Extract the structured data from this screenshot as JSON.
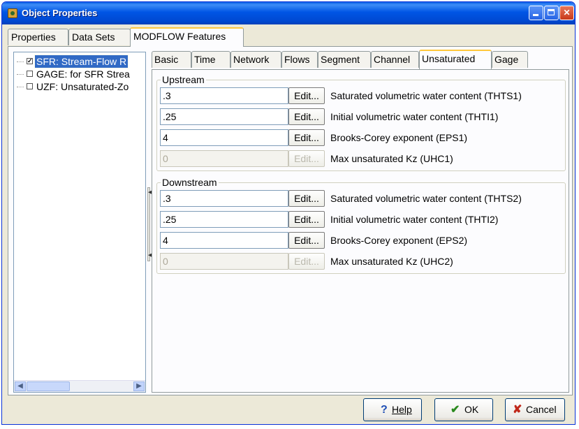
{
  "window": {
    "title": "Object Properties"
  },
  "tabs": [
    {
      "label": "Properties"
    },
    {
      "label": "Data Sets"
    },
    {
      "label": "MODFLOW Features"
    }
  ],
  "tree": {
    "items": [
      {
        "label": "SFR: Stream-Flow R",
        "checked": "✓"
      },
      {
        "label": "GAGE: for SFR Strea",
        "checked": ""
      },
      {
        "label": "UZF: Unsaturated-Zo",
        "checked": ""
      }
    ]
  },
  "subtabs": [
    {
      "label": "Basic"
    },
    {
      "label": "Time"
    },
    {
      "label": "Network"
    },
    {
      "label": "Flows"
    },
    {
      "label": "Segment"
    },
    {
      "label": "Channel"
    },
    {
      "label": "Unsaturated"
    },
    {
      "label": "Gage"
    }
  ],
  "upstream": {
    "title": "Upstream",
    "rows": [
      {
        "value": ".3",
        "button": "Edit...",
        "label": "Saturated volumetric water content (THTS1)"
      },
      {
        "value": ".25",
        "button": "Edit...",
        "label": "Initial volumetric water content (THTI1)"
      },
      {
        "value": "4",
        "button": "Edit...",
        "label": "Brooks-Corey exponent (EPS1)"
      },
      {
        "value": "0",
        "button": "Edit...",
        "label": "Max unsaturated Kz (UHC1)"
      }
    ]
  },
  "downstream": {
    "title": "Downstream",
    "rows": [
      {
        "value": ".3",
        "button": "Edit...",
        "label": "Saturated volumetric water content (THTS2)"
      },
      {
        "value": ".25",
        "button": "Edit...",
        "label": "Initial volumetric water content (THTI2)"
      },
      {
        "value": "4",
        "button": "Edit...",
        "label": "Brooks-Corey exponent (EPS2)"
      },
      {
        "value": "0",
        "button": "Edit...",
        "label": "Max unsaturated Kz (UHC2)"
      }
    ]
  },
  "buttons": {
    "help": {
      "icon": "?",
      "label": "Help"
    },
    "ok": {
      "icon": "✔",
      "label": "OK"
    },
    "cancel": {
      "icon": "✘",
      "label": "Cancel"
    }
  },
  "colors": {
    "help_icon": "#1f4fb5",
    "ok_icon": "#2a8a1e",
    "cancel_icon": "#c0281a"
  }
}
